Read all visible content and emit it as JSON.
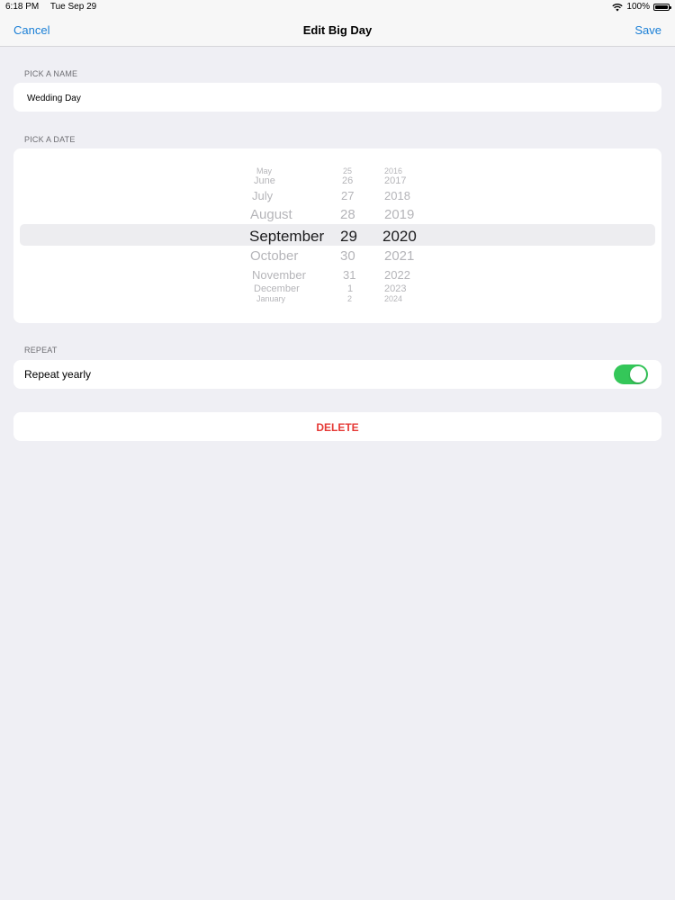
{
  "status_bar": {
    "time": "6:18 PM",
    "date": "Tue Sep 29",
    "battery": "100%",
    "icons": [
      "wifi-icon",
      "battery-icon"
    ]
  },
  "nav": {
    "cancel_label": "Cancel",
    "title": "Edit Big Day",
    "save_label": "Save",
    "accent_color": "#1a7fd6"
  },
  "name_section": {
    "header": "PICK A NAME",
    "value": "Wedding Day"
  },
  "date_section": {
    "header": "PICK A DATE",
    "months": [
      "May",
      "June",
      "July",
      "August",
      "September",
      "October",
      "November",
      "December",
      "January"
    ],
    "days": [
      "25",
      "26",
      "27",
      "28",
      "29",
      "30",
      "31",
      "1",
      "2"
    ],
    "years": [
      "2016",
      "2017",
      "2018",
      "2019",
      "2020",
      "2021",
      "2022",
      "2023",
      "2024"
    ],
    "selected": {
      "month": "September",
      "day": "29",
      "year": "2020"
    }
  },
  "repeat_section": {
    "header": "REPEAT",
    "label": "Repeat yearly",
    "enabled": true,
    "toggle_color": "#34c759"
  },
  "delete": {
    "label": "DELETE",
    "color": "#e53935"
  }
}
